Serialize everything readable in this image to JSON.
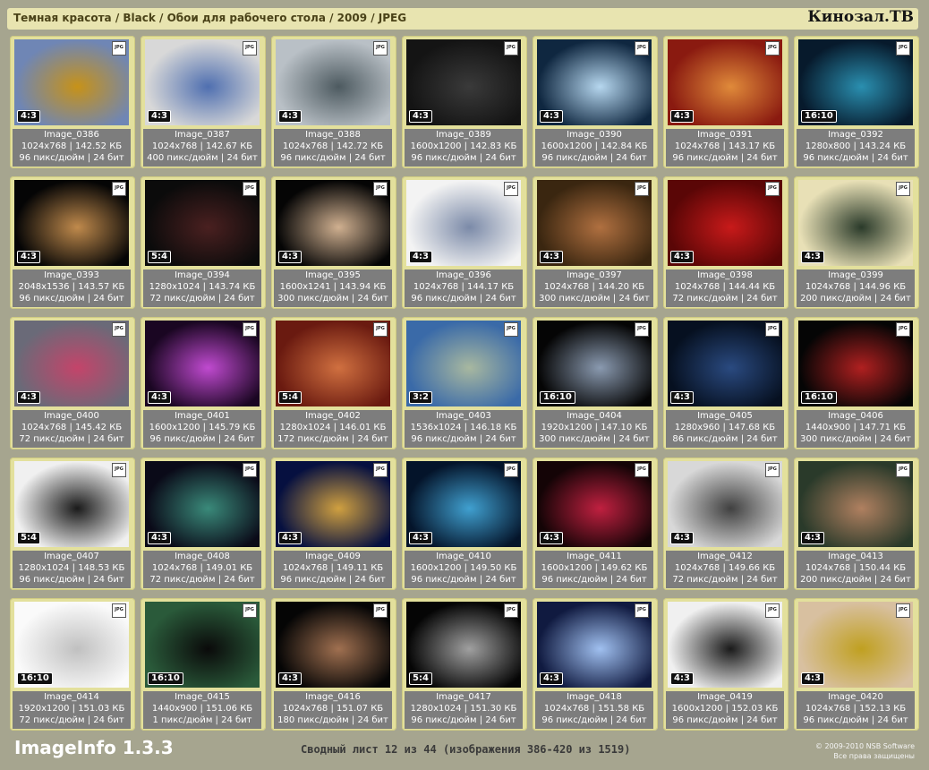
{
  "header": {
    "breadcrumb": "Темная красота / Black / Обои для рабочего стола / 2009 / JPEG",
    "logo": "Кинозал.ТВ"
  },
  "badge_label": "JPG",
  "images": [
    {
      "name": "Image_0386",
      "dims": "1024x768 | 142.52 КБ",
      "meta": "96 пикс/дюйм | 24 бит",
      "ratio": "4:3",
      "colors": [
        "#6f86b5",
        "#c79218"
      ]
    },
    {
      "name": "Image_0387",
      "dims": "1024x768 | 142.67 КБ",
      "meta": "400 пикс/дюйм | 24 бит",
      "ratio": "4:3",
      "colors": [
        "#d8d8d8",
        "#4f6fb0"
      ]
    },
    {
      "name": "Image_0388",
      "dims": "1024x768 | 142.72 КБ",
      "meta": "96 пикс/дюйм | 24 бит",
      "ratio": "4:3",
      "colors": [
        "#b9c0c6",
        "#4d5a60"
      ]
    },
    {
      "name": "Image_0389",
      "dims": "1600x1200 | 142.83 КБ",
      "meta": "96 пикс/дюйм | 24 бит",
      "ratio": "4:3",
      "colors": [
        "#141414",
        "#3a3a3a"
      ]
    },
    {
      "name": "Image_0390",
      "dims": "1600x1200 | 142.84 КБ",
      "meta": "96 пикс/дюйм | 24 бит",
      "ratio": "4:3",
      "colors": [
        "#0f2740",
        "#b6d7ef"
      ]
    },
    {
      "name": "Image_0391",
      "dims": "1024x768 | 143.17 КБ",
      "meta": "96 пикс/дюйм | 24 бит",
      "ratio": "4:3",
      "colors": [
        "#8a1a10",
        "#e08a3a"
      ]
    },
    {
      "name": "Image_0392",
      "dims": "1280x800 | 143.24 КБ",
      "meta": "96 пикс/дюйм | 24 бит",
      "ratio": "16:10",
      "colors": [
        "#071a2c",
        "#2a8fb0"
      ]
    },
    {
      "name": "Image_0393",
      "dims": "2048x1536 | 143.57 КБ",
      "meta": "96 пикс/дюйм | 24 бит",
      "ratio": "4:3",
      "colors": [
        "#050505",
        "#c08a4c"
      ]
    },
    {
      "name": "Image_0394",
      "dims": "1280x1024 | 143.74 КБ",
      "meta": "72 пикс/дюйм | 24 бит",
      "ratio": "5:4",
      "colors": [
        "#0b0b0b",
        "#4a2020"
      ]
    },
    {
      "name": "Image_0395",
      "dims": "1600x1241 | 143.94 КБ",
      "meta": "300 пикс/дюйм | 24 бит",
      "ratio": "4:3",
      "colors": [
        "#050505",
        "#d0b090"
      ]
    },
    {
      "name": "Image_0396",
      "dims": "1024x768 | 144.17 КБ",
      "meta": "96 пикс/дюйм | 24 бит",
      "ratio": "4:3",
      "colors": [
        "#f3f3f3",
        "#7b8aa8"
      ]
    },
    {
      "name": "Image_0397",
      "dims": "1024x768 | 144.20 КБ",
      "meta": "300 пикс/дюйм | 24 бит",
      "ratio": "4:3",
      "colors": [
        "#3a2610",
        "#b07040"
      ]
    },
    {
      "name": "Image_0398",
      "dims": "1024x768 | 144.44 КБ",
      "meta": "72 пикс/дюйм | 24 бит",
      "ratio": "4:3",
      "colors": [
        "#5a0606",
        "#c81a1a"
      ]
    },
    {
      "name": "Image_0399",
      "dims": "1024x768 | 144.96 КБ",
      "meta": "200 пикс/дюйм | 24 бит",
      "ratio": "4:3",
      "colors": [
        "#e8e0b6",
        "#2a3a2a"
      ]
    },
    {
      "name": "Image_0400",
      "dims": "1024x768 | 145.42 КБ",
      "meta": "72 пикс/дюйм | 24 бит",
      "ratio": "4:3",
      "colors": [
        "#6a6a78",
        "#c4446a"
      ]
    },
    {
      "name": "Image_0401",
      "dims": "1600x1200 | 145.79 КБ",
      "meta": "96 пикс/дюйм | 24 бит",
      "ratio": "4:3",
      "colors": [
        "#1a0622",
        "#c04ad0"
      ]
    },
    {
      "name": "Image_0402",
      "dims": "1280x1024 | 146.01 КБ",
      "meta": "172 пикс/дюйм | 24 бит",
      "ratio": "5:4",
      "colors": [
        "#6a1a10",
        "#d07040"
      ]
    },
    {
      "name": "Image_0403",
      "dims": "1536x1024 | 146.18 КБ",
      "meta": "96 пикс/дюйм | 24 бит",
      "ratio": "3:2",
      "colors": [
        "#3a6aa8",
        "#a8b8a0"
      ]
    },
    {
      "name": "Image_0404",
      "dims": "1920x1200 | 147.10 КБ",
      "meta": "300 пикс/дюйм | 24 бит",
      "ratio": "16:10",
      "colors": [
        "#050505",
        "#8a9ab0"
      ]
    },
    {
      "name": "Image_0405",
      "dims": "1280x960 | 147.68 КБ",
      "meta": "86 пикс/дюйм | 24 бит",
      "ratio": "4:3",
      "colors": [
        "#061020",
        "#2a4a80"
      ]
    },
    {
      "name": "Image_0406",
      "dims": "1440x900 | 147.71 КБ",
      "meta": "300 пикс/дюйм | 24 бит",
      "ratio": "16:10",
      "colors": [
        "#050505",
        "#b02020"
      ]
    },
    {
      "name": "Image_0407",
      "dims": "1280x1024 | 148.53 КБ",
      "meta": "96 пикс/дюйм | 24 бит",
      "ratio": "5:4",
      "colors": [
        "#f0f0f0",
        "#1a1a1a"
      ]
    },
    {
      "name": "Image_0408",
      "dims": "1024x768 | 149.01 КБ",
      "meta": "72 пикс/дюйм | 24 бит",
      "ratio": "4:3",
      "colors": [
        "#0a0a18",
        "#3a8a7a"
      ]
    },
    {
      "name": "Image_0409",
      "dims": "1024x768 | 149.11 КБ",
      "meta": "96 пикс/дюйм | 24 бит",
      "ratio": "4:3",
      "colors": [
        "#061040",
        "#d0a040"
      ]
    },
    {
      "name": "Image_0410",
      "dims": "1600x1200 | 149.50 КБ",
      "meta": "96 пикс/дюйм | 24 бит",
      "ratio": "4:3",
      "colors": [
        "#04142a",
        "#40a0d0"
      ]
    },
    {
      "name": "Image_0411",
      "dims": "1600x1200 | 149.62 КБ",
      "meta": "96 пикс/дюйм | 24 бит",
      "ratio": "4:3",
      "colors": [
        "#140406",
        "#c02040"
      ]
    },
    {
      "name": "Image_0412",
      "dims": "1024x768 | 149.66 КБ",
      "meta": "72 пикс/дюйм | 24 бит",
      "ratio": "4:3",
      "colors": [
        "#d8d8d8",
        "#404040"
      ]
    },
    {
      "name": "Image_0413",
      "dims": "1024x768 | 150.44 КБ",
      "meta": "200 пикс/дюйм | 24 бит",
      "ratio": "4:3",
      "colors": [
        "#2a3a2a",
        "#b08060"
      ]
    },
    {
      "name": "Image_0414",
      "dims": "1920x1200 | 151.03 КБ",
      "meta": "72 пикс/дюйм | 24 бит",
      "ratio": "16:10",
      "colors": [
        "#fafafa",
        "#c0c0c0"
      ]
    },
    {
      "name": "Image_0415",
      "dims": "1440x900 | 151.06 КБ",
      "meta": "1 пикс/дюйм | 24 бит",
      "ratio": "16:10",
      "colors": [
        "#2a5a3a",
        "#0a0a0a"
      ]
    },
    {
      "name": "Image_0416",
      "dims": "1024x768 | 151.07 КБ",
      "meta": "180 пикс/дюйм | 24 бит",
      "ratio": "4:3",
      "colors": [
        "#050505",
        "#a07050"
      ]
    },
    {
      "name": "Image_0417",
      "dims": "1280x1024 | 151.30 КБ",
      "meta": "96 пикс/дюйм | 24 бит",
      "ratio": "5:4",
      "colors": [
        "#050505",
        "#a0a0a0"
      ]
    },
    {
      "name": "Image_0418",
      "dims": "1024x768 | 151.58 КБ",
      "meta": "96 пикс/дюйм | 24 бит",
      "ratio": "4:3",
      "colors": [
        "#101a40",
        "#a0c0f0"
      ]
    },
    {
      "name": "Image_0419",
      "dims": "1600x1200 | 152.03 КБ",
      "meta": "96 пикс/дюйм | 24 бит",
      "ratio": "4:3",
      "colors": [
        "#f0f0f0",
        "#1a1a1a"
      ]
    },
    {
      "name": "Image_0420",
      "dims": "1024x768 | 152.13 КБ",
      "meta": "96 пикс/дюйм | 24 бит",
      "ratio": "4:3",
      "colors": [
        "#d8c0a0",
        "#c0a020"
      ]
    }
  ],
  "footer": {
    "app_name": "ImageInfo 1.3.3",
    "summary": "Сводный лист 12 из 44 (изображения 386-420 из 1519)",
    "copyright_line1": "© 2009-2010 NSB Software",
    "copyright_line2": "Все права защищены"
  }
}
